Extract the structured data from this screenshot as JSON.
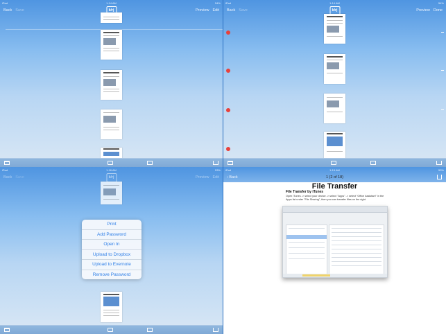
{
  "panes": {
    "top_left": {
      "status": {
        "device": "iPad",
        "time": "1:14 AM",
        "battery": "54%"
      },
      "nav": {
        "back": "Back",
        "save": "Save",
        "preview": "Preview",
        "edit": "Edit",
        "logo": "b/rj"
      },
      "thumbs": [
        "File Transfer",
        "File Transfer",
        "",
        "File Management"
      ]
    },
    "top_right": {
      "status": {
        "device": "iPad",
        "time": "1:14 AM",
        "battery": "54%"
      },
      "nav": {
        "back": "Back",
        "save": "Save",
        "preview": "Preview",
        "done": "Done",
        "logo": "b/rj"
      },
      "thumbs": [
        "",
        "",
        "",
        "File Management"
      ]
    },
    "bottom_left": {
      "status": {
        "device": "iPad",
        "time": "1:16 AM",
        "battery": "53%"
      },
      "nav": {
        "back": "Back",
        "save": "Save",
        "preview": "Preview",
        "edit": "Edit",
        "logo": "b/rj"
      },
      "menu": [
        "Print",
        "Add Password",
        "Open In",
        "Upload to Dropbox",
        "Upload to Evernote",
        "Remove Password"
      ],
      "thumbs": [
        "",
        "File Management"
      ]
    },
    "bottom_right": {
      "status": {
        "device": "iPad",
        "time": "1:15 AM",
        "battery": "53%"
      },
      "nav": {
        "back": "Back",
        "page_title": "1 (2 of 18)"
      },
      "doc": {
        "title": "File Transfer",
        "subtitle": "File Transfer by iTunes",
        "body": "Open iTunes -> select your device -> select \"Apps\" -> select \"Office Assistant\" in the Apps list under \"File Sharing\", then you can transfer files on the right."
      }
    }
  },
  "colors": {
    "accent": "#2d7ee7",
    "delete": "#e8413c",
    "sky_top": "#4f95e1",
    "sky_bottom": "#d9e7f4"
  },
  "icons": [
    "trash-icon",
    "settings-icon",
    "mail-icon",
    "share-icon",
    "back-chevron-icon"
  ]
}
